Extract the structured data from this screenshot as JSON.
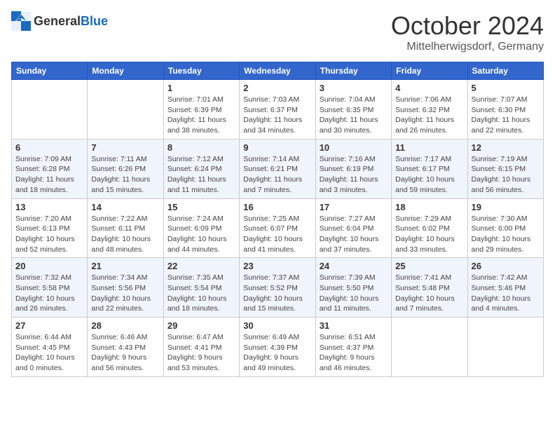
{
  "header": {
    "logo_general": "General",
    "logo_blue": "Blue",
    "month_title": "October 2024",
    "location": "Mittelherwigsdorf, Germany"
  },
  "days_of_week": [
    "Sunday",
    "Monday",
    "Tuesday",
    "Wednesday",
    "Thursday",
    "Friday",
    "Saturday"
  ],
  "weeks": [
    [
      {
        "day": "",
        "info": ""
      },
      {
        "day": "",
        "info": ""
      },
      {
        "day": "1",
        "info": "Sunrise: 7:01 AM\nSunset: 6:39 PM\nDaylight: 11 hours and 38 minutes."
      },
      {
        "day": "2",
        "info": "Sunrise: 7:03 AM\nSunset: 6:37 PM\nDaylight: 11 hours and 34 minutes."
      },
      {
        "day": "3",
        "info": "Sunrise: 7:04 AM\nSunset: 6:35 PM\nDaylight: 11 hours and 30 minutes."
      },
      {
        "day": "4",
        "info": "Sunrise: 7:06 AM\nSunset: 6:32 PM\nDaylight: 11 hours and 26 minutes."
      },
      {
        "day": "5",
        "info": "Sunrise: 7:07 AM\nSunset: 6:30 PM\nDaylight: 11 hours and 22 minutes."
      }
    ],
    [
      {
        "day": "6",
        "info": "Sunrise: 7:09 AM\nSunset: 6:28 PM\nDaylight: 11 hours and 18 minutes."
      },
      {
        "day": "7",
        "info": "Sunrise: 7:11 AM\nSunset: 6:26 PM\nDaylight: 11 hours and 15 minutes."
      },
      {
        "day": "8",
        "info": "Sunrise: 7:12 AM\nSunset: 6:24 PM\nDaylight: 11 hours and 11 minutes."
      },
      {
        "day": "9",
        "info": "Sunrise: 7:14 AM\nSunset: 6:21 PM\nDaylight: 11 hours and 7 minutes."
      },
      {
        "day": "10",
        "info": "Sunrise: 7:16 AM\nSunset: 6:19 PM\nDaylight: 11 hours and 3 minutes."
      },
      {
        "day": "11",
        "info": "Sunrise: 7:17 AM\nSunset: 6:17 PM\nDaylight: 10 hours and 59 minutes."
      },
      {
        "day": "12",
        "info": "Sunrise: 7:19 AM\nSunset: 6:15 PM\nDaylight: 10 hours and 56 minutes."
      }
    ],
    [
      {
        "day": "13",
        "info": "Sunrise: 7:20 AM\nSunset: 6:13 PM\nDaylight: 10 hours and 52 minutes."
      },
      {
        "day": "14",
        "info": "Sunrise: 7:22 AM\nSunset: 6:11 PM\nDaylight: 10 hours and 48 minutes."
      },
      {
        "day": "15",
        "info": "Sunrise: 7:24 AM\nSunset: 6:09 PM\nDaylight: 10 hours and 44 minutes."
      },
      {
        "day": "16",
        "info": "Sunrise: 7:25 AM\nSunset: 6:07 PM\nDaylight: 10 hours and 41 minutes."
      },
      {
        "day": "17",
        "info": "Sunrise: 7:27 AM\nSunset: 6:04 PM\nDaylight: 10 hours and 37 minutes."
      },
      {
        "day": "18",
        "info": "Sunrise: 7:29 AM\nSunset: 6:02 PM\nDaylight: 10 hours and 33 minutes."
      },
      {
        "day": "19",
        "info": "Sunrise: 7:30 AM\nSunset: 6:00 PM\nDaylight: 10 hours and 29 minutes."
      }
    ],
    [
      {
        "day": "20",
        "info": "Sunrise: 7:32 AM\nSunset: 5:58 PM\nDaylight: 10 hours and 26 minutes."
      },
      {
        "day": "21",
        "info": "Sunrise: 7:34 AM\nSunset: 5:56 PM\nDaylight: 10 hours and 22 minutes."
      },
      {
        "day": "22",
        "info": "Sunrise: 7:35 AM\nSunset: 5:54 PM\nDaylight: 10 hours and 18 minutes."
      },
      {
        "day": "23",
        "info": "Sunrise: 7:37 AM\nSunset: 5:52 PM\nDaylight: 10 hours and 15 minutes."
      },
      {
        "day": "24",
        "info": "Sunrise: 7:39 AM\nSunset: 5:50 PM\nDaylight: 10 hours and 11 minutes."
      },
      {
        "day": "25",
        "info": "Sunrise: 7:41 AM\nSunset: 5:48 PM\nDaylight: 10 hours and 7 minutes."
      },
      {
        "day": "26",
        "info": "Sunrise: 7:42 AM\nSunset: 5:46 PM\nDaylight: 10 hours and 4 minutes."
      }
    ],
    [
      {
        "day": "27",
        "info": "Sunrise: 6:44 AM\nSunset: 4:45 PM\nDaylight: 10 hours and 0 minutes."
      },
      {
        "day": "28",
        "info": "Sunrise: 6:46 AM\nSunset: 4:43 PM\nDaylight: 9 hours and 56 minutes."
      },
      {
        "day": "29",
        "info": "Sunrise: 6:47 AM\nSunset: 4:41 PM\nDaylight: 9 hours and 53 minutes."
      },
      {
        "day": "30",
        "info": "Sunrise: 6:49 AM\nSunset: 4:39 PM\nDaylight: 9 hours and 49 minutes."
      },
      {
        "day": "31",
        "info": "Sunrise: 6:51 AM\nSunset: 4:37 PM\nDaylight: 9 hours and 46 minutes."
      },
      {
        "day": "",
        "info": ""
      },
      {
        "day": "",
        "info": ""
      }
    ]
  ]
}
